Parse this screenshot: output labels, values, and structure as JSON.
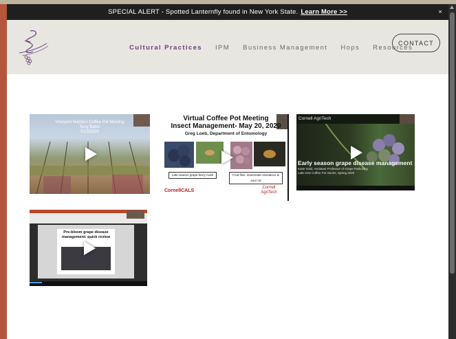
{
  "alert": {
    "text": "SPECIAL ALERT - Spotted Lanternfly found in New York State.",
    "link": "Learn More >>",
    "close": "×"
  },
  "nav": {
    "items": [
      {
        "label": "Cultural Practices",
        "active": true
      },
      {
        "label": "IPM",
        "active": false
      },
      {
        "label": "Business Management",
        "active": false
      },
      {
        "label": "Hops",
        "active": false
      },
      {
        "label": "Resources",
        "active": false
      }
    ],
    "contact_label": "CONTACT"
  },
  "colors": {
    "accent": "#6b3d7a",
    "alert_bg": "#1f1f1f",
    "header_bg": "#e8e6e1"
  },
  "videos": [
    {
      "title": "Vineyard Nutrition Coffee Pot Meeting",
      "line2": "Terry Bates",
      "line3": "5/13/2020"
    },
    {
      "title": "Virtual Coffee Pot Meeting",
      "subtitle": "Insect Management- May 20, 2020",
      "presenter": "Greg Loeb, Department of Entomology",
      "caption_left": "Late-season grape berry moth",
      "caption_right": "Fruit flies, insecticide resistance & sour rot",
      "logo_left": "CornellCALS",
      "logo_right": "Cornell AgriTech"
    },
    {
      "brand": "Cornell AgriTech",
      "title": "Early season grape disease management",
      "line2": "Katie Gold, Assistant Professor of Grape Pathology",
      "line3": "Lake Erie Coffee Pot Series, Spring 2020"
    },
    {
      "title": "Pre-bloom grape disease management: quick review"
    }
  ]
}
